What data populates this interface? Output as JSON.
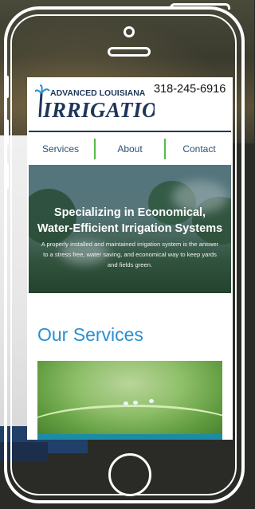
{
  "header": {
    "logo_top": "ADVANCED LOUISIANA",
    "logo_main": "IRRIGATION",
    "phone": "318-245-6916"
  },
  "nav": {
    "items": [
      {
        "label": "Services"
      },
      {
        "label": "About"
      },
      {
        "label": "Contact"
      }
    ]
  },
  "hero": {
    "title_line1": "Specializing in Economical,",
    "title_line2": "Water-Efficient Irrigation Systems",
    "text": "A properly installed and maintained irrigation system is the answer to a stress free, water saving, and economical way to keep yards and fields green."
  },
  "services": {
    "title": "Our Services"
  },
  "colors": {
    "brand_navy": "#1f3659",
    "nav_separator_green": "#55bb4a",
    "services_blue": "#2a8fd0",
    "accent_teal": "#1c8ca6"
  }
}
